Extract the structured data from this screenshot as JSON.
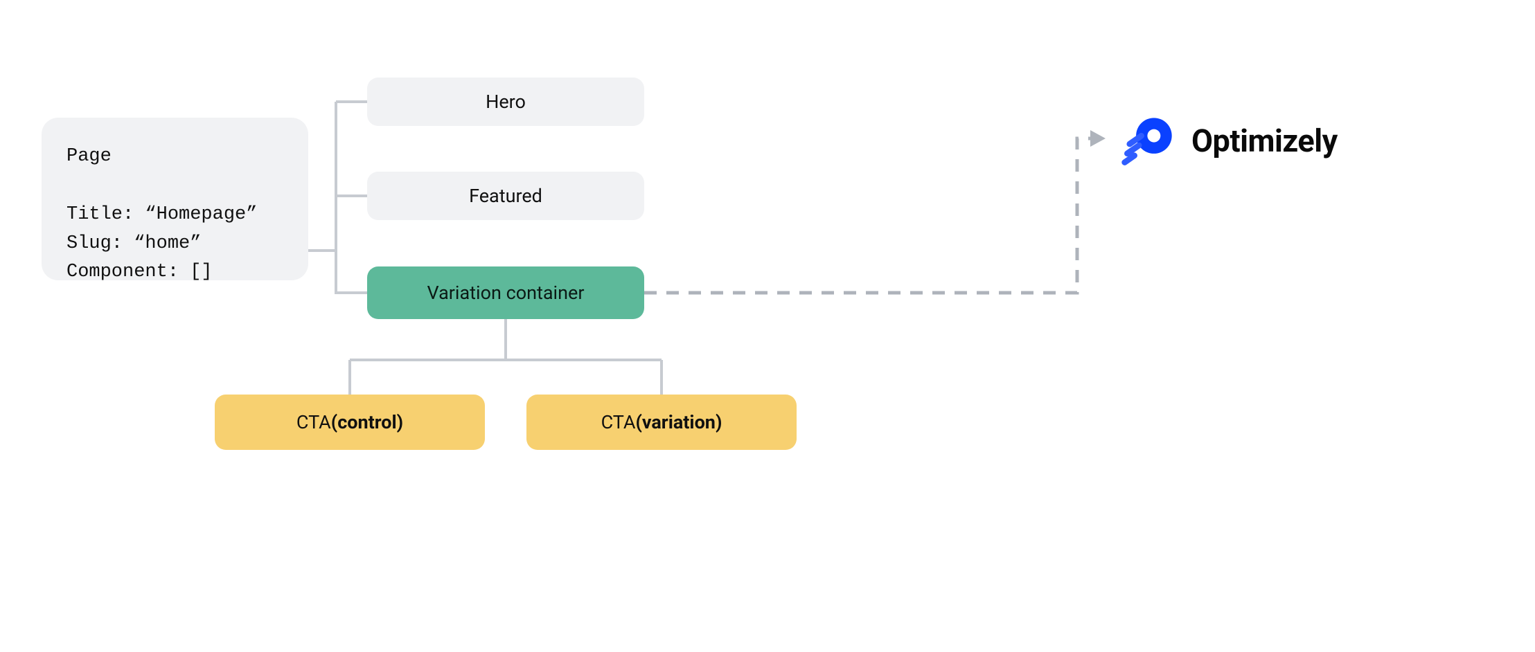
{
  "page_card": {
    "heading": "Page",
    "title_line": "Title: “Homepage”",
    "slug_line": "Slug: “home”",
    "component_line": "Component: []"
  },
  "nodes": {
    "hero": "Hero",
    "featured": "Featured",
    "variation_container": "Variation container"
  },
  "cta": {
    "control_prefix": "CTA ",
    "control_bold": "(control)",
    "variation_prefix": "CTA ",
    "variation_bold": "(variation)"
  },
  "brand": {
    "name": "Optimizely"
  }
}
